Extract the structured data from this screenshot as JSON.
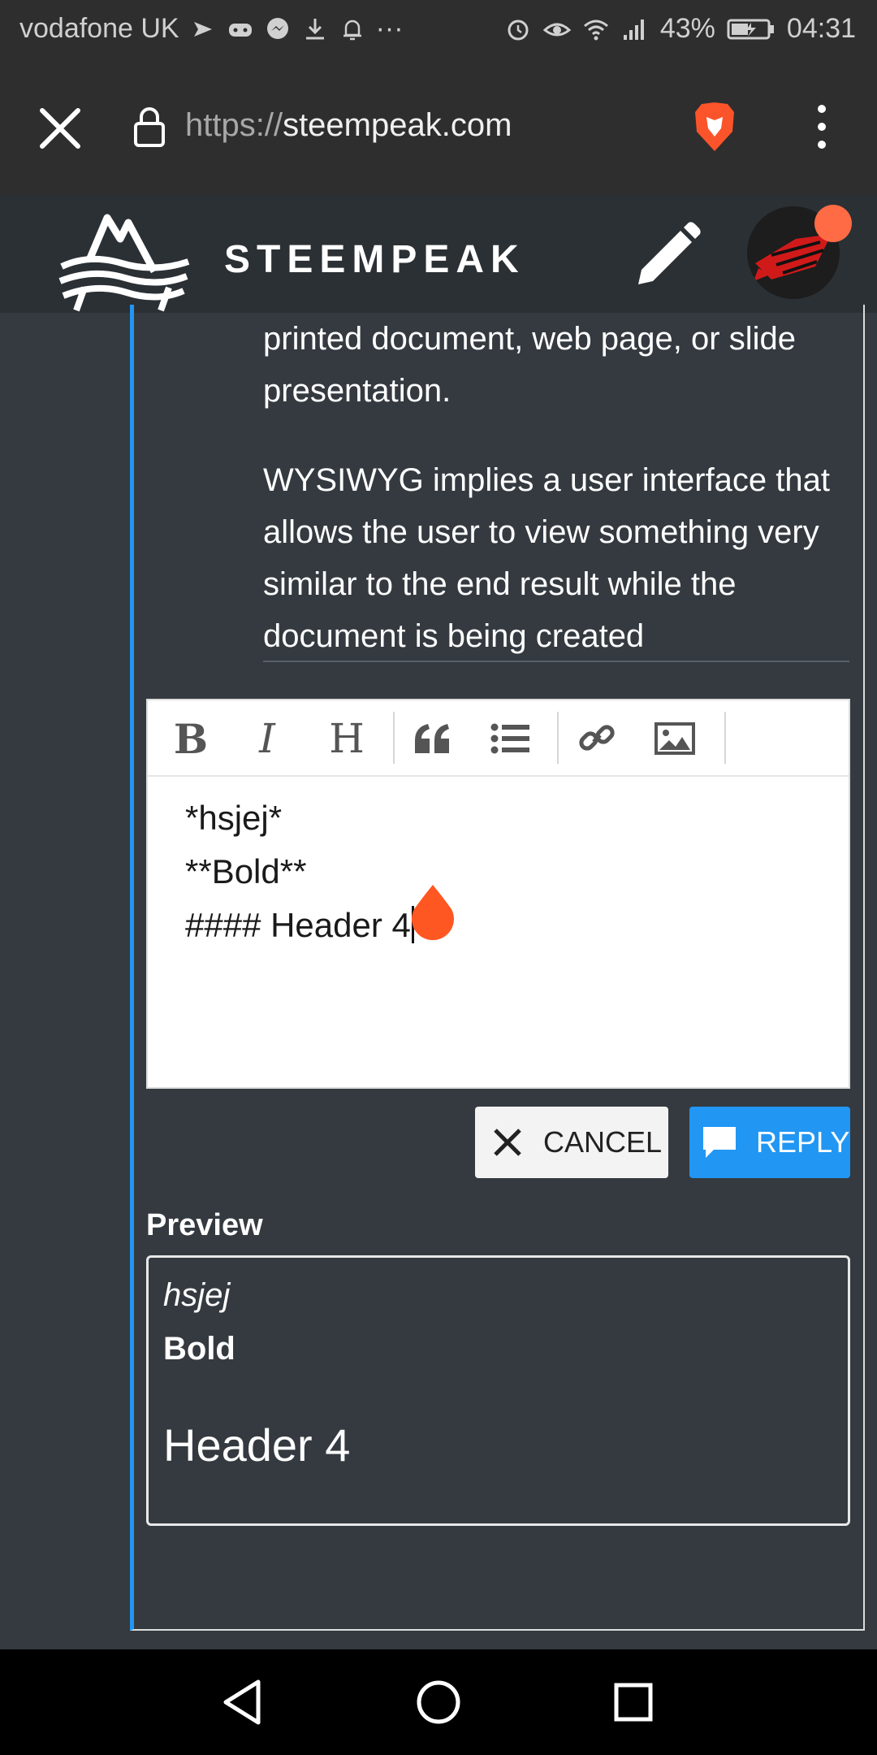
{
  "status_bar": {
    "carrier": "vodafone UK",
    "battery": "43%",
    "time": "04:31"
  },
  "browser": {
    "url_scheme": "https://",
    "url_host": "steempeak.com"
  },
  "header": {
    "logo_text": "STEEMPEAK"
  },
  "post": {
    "paragraph1": "printed document, web page, or slide presentation.",
    "paragraph2": "WYSIWYG implies a user interface that allows the user to view something very similar to the end result while the document is being created"
  },
  "editor": {
    "toolbar": {
      "bold": "B",
      "italic": "I",
      "heading": "H"
    },
    "lines": [
      "*hsjej*",
      "**Bold**",
      "#### Header 4"
    ]
  },
  "actions": {
    "cancel_label": "CANCEL",
    "reply_label": "REPLY"
  },
  "preview": {
    "label": "Preview",
    "italic_text": "hsjej",
    "bold_text": "Bold",
    "header_text": "Header 4"
  },
  "colors": {
    "accent": "#2196f3",
    "notification": "#ff6b45",
    "background": "#343a40"
  }
}
